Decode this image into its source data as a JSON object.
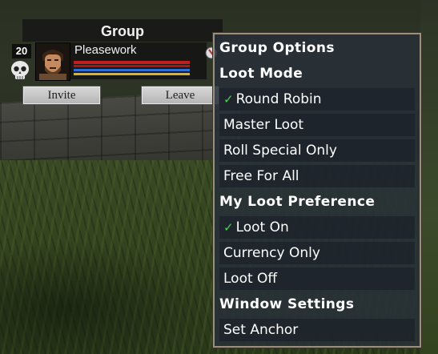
{
  "group": {
    "title": "Group",
    "invite_label": "Invite",
    "leave_label": "Leave",
    "member": {
      "level": "20",
      "name": "Pleasework",
      "health_fraction": 1.0,
      "mana_fraction": 1.0,
      "endurance_fraction": 1.0
    }
  },
  "menu": {
    "title": "Group Options",
    "sections": [
      {
        "heading": "Loot Mode",
        "items": [
          {
            "label": "Round Robin",
            "checked": true
          },
          {
            "label": "Master Loot",
            "checked": false
          },
          {
            "label": "Roll Special Only",
            "checked": false
          },
          {
            "label": "Free For All",
            "checked": false
          }
        ]
      },
      {
        "heading": "My Loot Preference",
        "items": [
          {
            "label": "Loot On",
            "checked": true
          },
          {
            "label": "Currency Only",
            "checked": false
          },
          {
            "label": "Loot Off",
            "checked": false
          }
        ]
      },
      {
        "heading": "Window Settings",
        "items": [
          {
            "label": "Set Anchor",
            "checked": false
          }
        ]
      }
    ],
    "check_glyph": "✓",
    "check_color": "#4fd04f"
  },
  "colors": {
    "health": "#c01e1e",
    "mana": "#2d6fd8",
    "endurance": "#d8b428",
    "menu_border": "#9a8f7b"
  },
  "icons": {
    "member_status": "skull-icon",
    "check": "checkmark-icon"
  }
}
